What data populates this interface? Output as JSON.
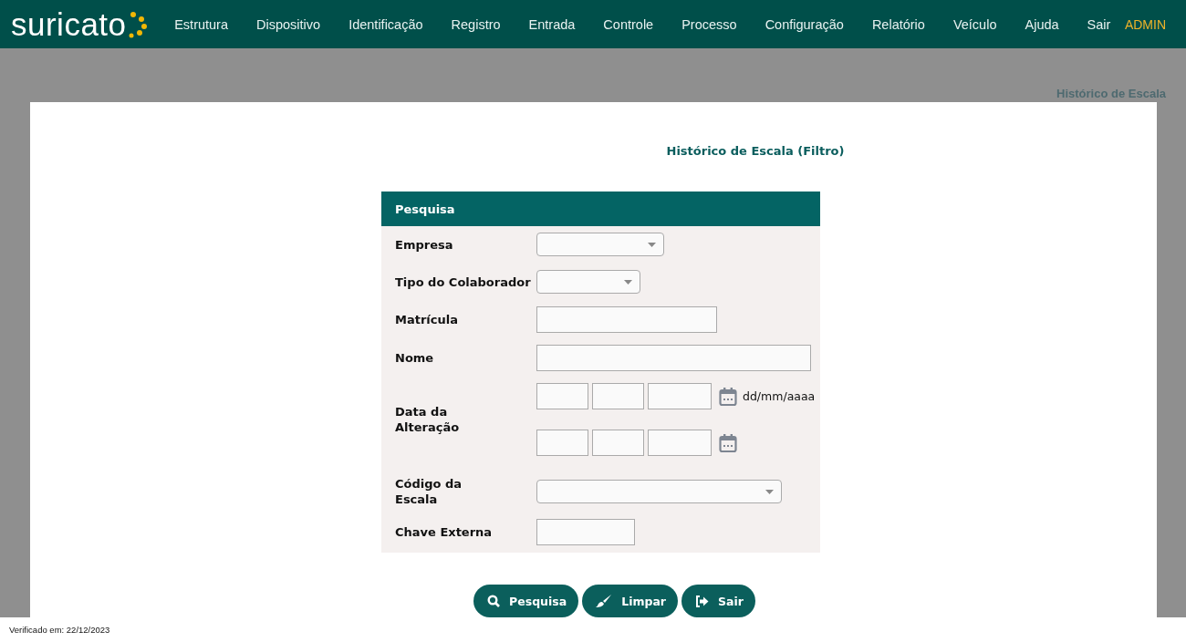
{
  "brand": {
    "name": "suricato"
  },
  "nav": [
    {
      "label": "Estrutura"
    },
    {
      "label": "Dispositivo"
    },
    {
      "label": "Identificação"
    },
    {
      "label": "Registro"
    },
    {
      "label": "Entrada"
    },
    {
      "label": "Controle"
    },
    {
      "label": "Processo"
    },
    {
      "label": "Configuração"
    },
    {
      "label": "Relatório"
    },
    {
      "label": "Veículo"
    },
    {
      "label": "Ajuda"
    },
    {
      "label": "Sair"
    }
  ],
  "user": "ADMIN",
  "breadcrumb": "Histórico de Escala",
  "page_title": "Histórico de Escala (Filtro)",
  "form": {
    "title": "Pesquisa",
    "fields": [
      {
        "label": "Empresa",
        "kind": "select"
      },
      {
        "label": "Tipo do Colaborador",
        "kind": "select"
      },
      {
        "label": "Matrícula",
        "kind": "text"
      },
      {
        "label": "Nome",
        "kind": "text"
      },
      {
        "label": "Data da Alteração",
        "kind": "date_range",
        "hint": "dd/mm/aaaa"
      },
      {
        "label": "Código da Escala",
        "kind": "select"
      },
      {
        "label": "Chave Externa",
        "kind": "text"
      }
    ]
  },
  "buttons": [
    {
      "label": "Pesquisa",
      "kind": "search"
    },
    {
      "label": "Limpar",
      "kind": "clear"
    },
    {
      "label": "Sair",
      "kind": "exit"
    }
  ],
  "footer": "Verificado em: 22/12/2023"
}
